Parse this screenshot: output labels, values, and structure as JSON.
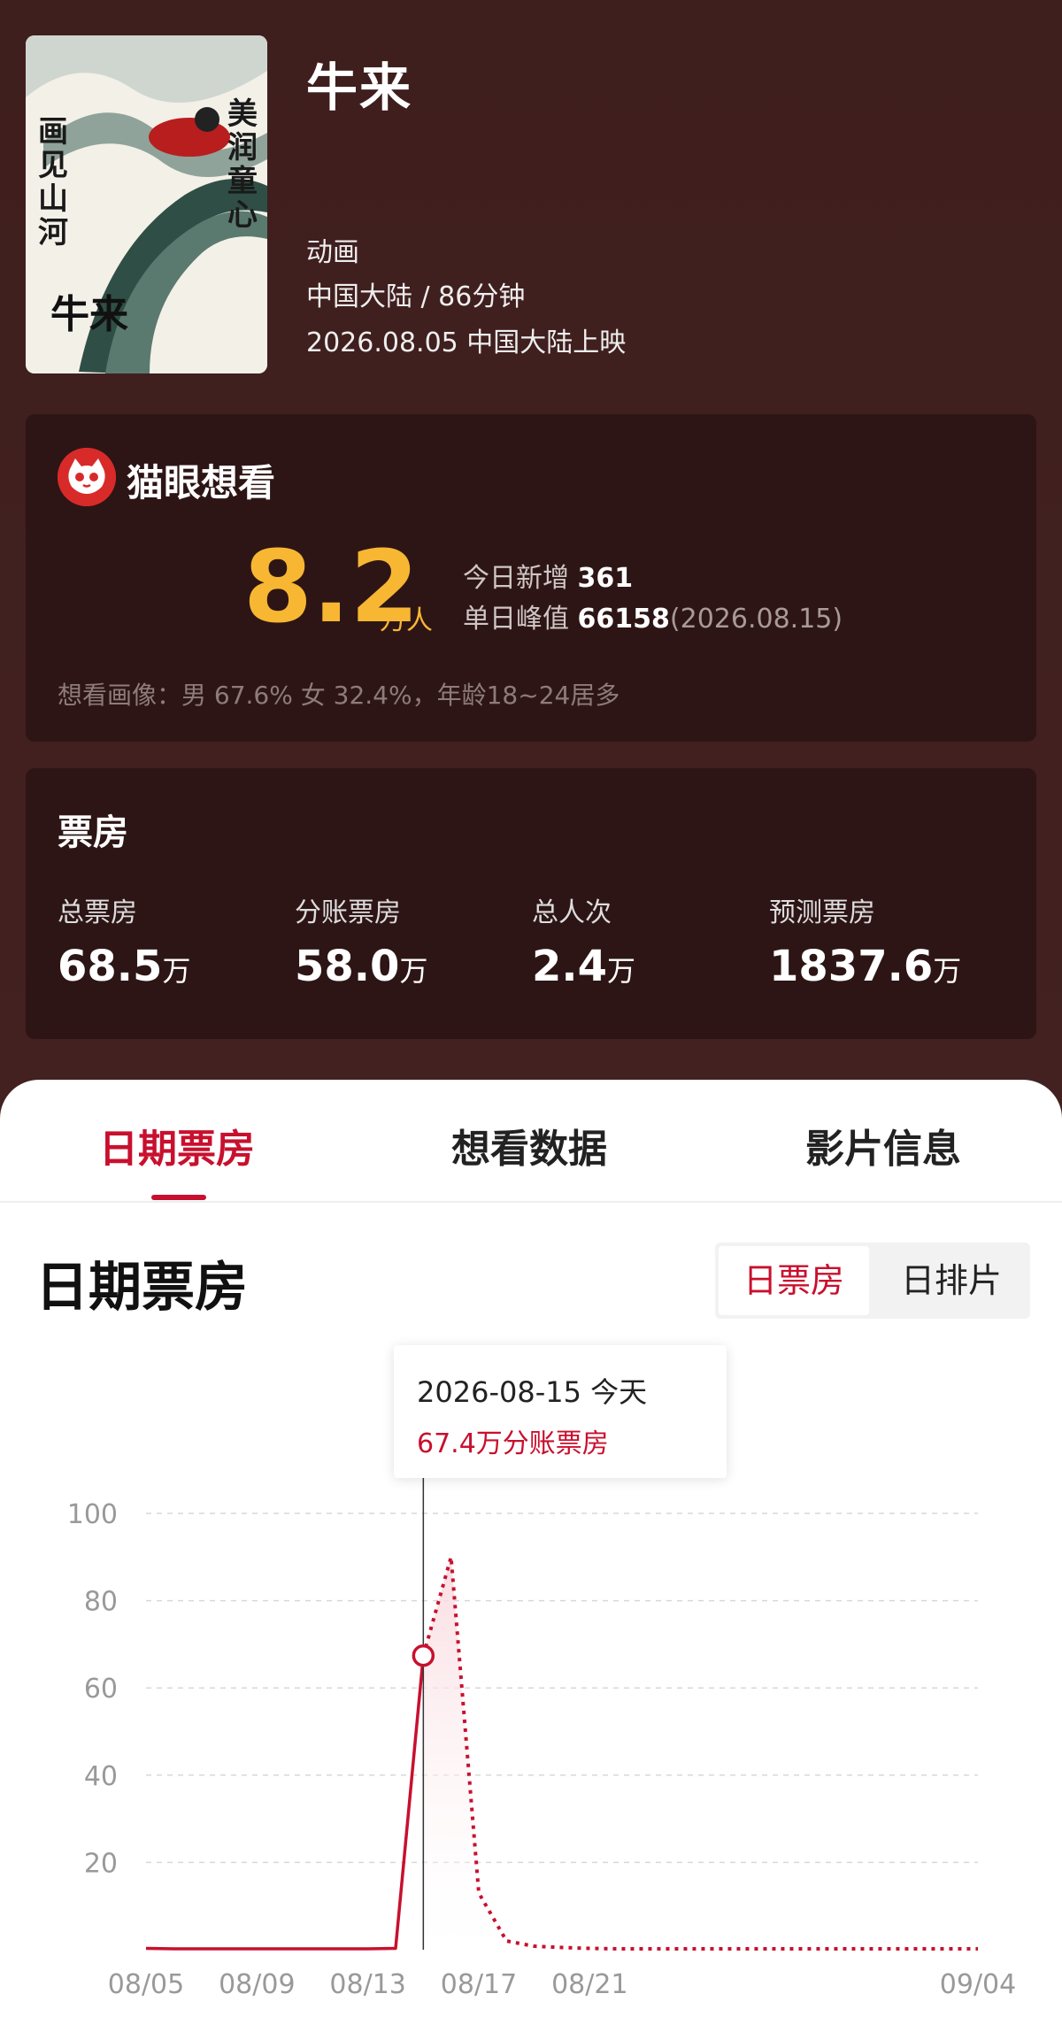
{
  "movie": {
    "title": "牛来",
    "genre": "动画",
    "region_duration": "中国大陆 / 86分钟",
    "release": "2026.08.05 中国大陆上映",
    "poster_text": [
      "美润童心",
      "画见山河",
      "牛来"
    ]
  },
  "want": {
    "title": "猫眼想看",
    "count": "8.2",
    "unit": "万人",
    "today_label": "今日新增",
    "today_value": "361",
    "peak_label": "单日峰值",
    "peak_value": "66158",
    "peak_date": "(2026.08.15)",
    "portrait": "想看画像：男 67.6% 女 32.4%，年龄18~24居多"
  },
  "boxoffice": {
    "title": "票房",
    "items": [
      {
        "label": "总票房",
        "value": "68.5",
        "unit": "万"
      },
      {
        "label": "分账票房",
        "value": "58.0",
        "unit": "万"
      },
      {
        "label": "总人次",
        "value": "2.4",
        "unit": "万"
      },
      {
        "label": "预测票房",
        "value": "1837.6",
        "unit": "万"
      }
    ]
  },
  "tabs": [
    "日期票房",
    "想看数据",
    "影片信息"
  ],
  "section": {
    "title": "日期票房",
    "toggle": [
      "日票房",
      "日排片"
    ]
  },
  "tooltip": {
    "date": "2026-08-15 今天",
    "value": "67.4万分账票房"
  },
  "colors": {
    "accent": "#c8102e",
    "gold": "#f7b733",
    "bg": "#3e1f1f"
  },
  "chart_data": {
    "type": "line",
    "x": [
      "08/05",
      "08/06",
      "08/07",
      "08/08",
      "08/09",
      "08/10",
      "08/11",
      "08/12",
      "08/13",
      "08/14",
      "08/15",
      "08/16",
      "08/17",
      "08/18",
      "08/19",
      "08/20",
      "08/21",
      "08/22",
      "08/23",
      "08/24",
      "08/25",
      "08/26",
      "08/27",
      "08/28",
      "08/29",
      "08/30",
      "08/31",
      "09/01",
      "09/02",
      "09/03",
      "09/04"
    ],
    "series": [
      {
        "values": [
          0.3,
          0.2,
          0.2,
          0.2,
          0.2,
          0.2,
          0.2,
          0.2,
          0.2,
          0.3,
          67.4,
          null,
          null,
          null,
          null,
          null,
          null,
          null,
          null,
          null,
          null,
          null,
          null,
          null,
          null,
          null,
          null,
          null,
          null,
          null,
          null
        ],
        "style": "solid"
      },
      {
        "values": [
          null,
          null,
          null,
          null,
          null,
          null,
          null,
          null,
          null,
          null,
          67.4,
          90,
          13,
          2,
          0.8,
          0.5,
          0.3,
          0.2,
          0.2,
          0.2,
          0.2,
          0.2,
          0.2,
          0.2,
          0.2,
          0.2,
          0.2,
          0.2,
          0.2,
          0.2,
          0.2
        ],
        "style": "dotted"
      }
    ],
    "xticks": [
      "08/05",
      "08/09",
      "08/13",
      "08/17",
      "08/21",
      "09/04"
    ],
    "yticks": [
      "20",
      "40",
      "60",
      "80",
      "100"
    ],
    "ylim": [
      0,
      100
    ],
    "grid": true,
    "highlight_index": 10
  }
}
